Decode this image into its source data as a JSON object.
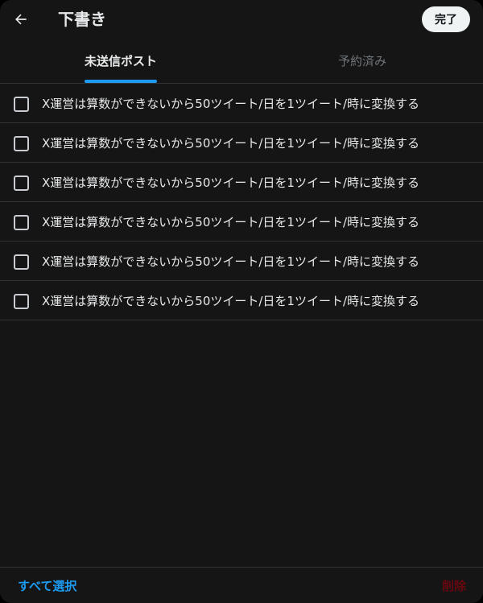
{
  "header": {
    "title": "下書き",
    "back_icon": "arrow-left-icon",
    "done_label": "完了"
  },
  "tabs": [
    {
      "label": "未送信ポスト",
      "active": true
    },
    {
      "label": "予約済み",
      "active": false
    }
  ],
  "drafts": [
    {
      "text": "X運営は算数ができないから50ツイート/日を1ツイート/時に変換する",
      "checked": false
    },
    {
      "text": "X運営は算数ができないから50ツイート/日を1ツイート/時に変換する",
      "checked": false
    },
    {
      "text": "X運営は算数ができないから50ツイート/日を1ツイート/時に変換する",
      "checked": false
    },
    {
      "text": "X運営は算数ができないから50ツイート/日を1ツイート/時に変換する",
      "checked": false
    },
    {
      "text": "X運営は算数ができないから50ツイート/日を1ツイート/時に変換する",
      "checked": false
    },
    {
      "text": "X運営は算数ができないから50ツイート/日を1ツイート/時に変換する",
      "checked": false
    }
  ],
  "footer": {
    "select_all_label": "すべて選択",
    "delete_label": "削除"
  },
  "colors": {
    "background": "#151515",
    "accent": "#1d9bf0",
    "danger_disabled": "#67070f",
    "divider": "#2f3336"
  }
}
